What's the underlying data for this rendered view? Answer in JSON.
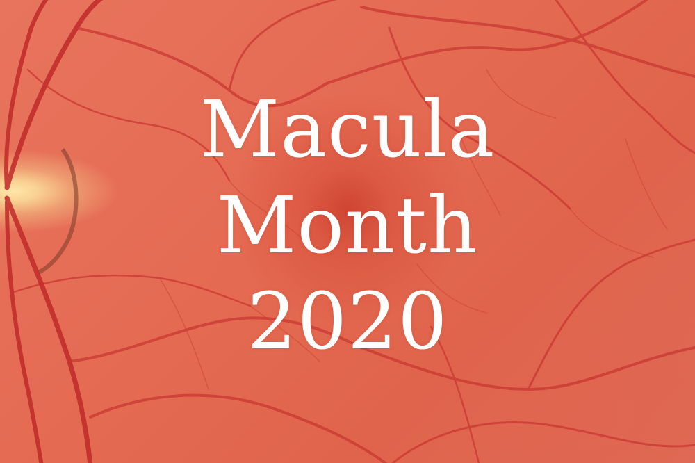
{
  "title": {
    "line1": "Macula",
    "line2": "Month",
    "line3": "2020"
  },
  "colors": {
    "background": "#e2634c",
    "text": "#ffffff",
    "optic_disc": "#fbdca0",
    "vessel": "#c4302a"
  }
}
